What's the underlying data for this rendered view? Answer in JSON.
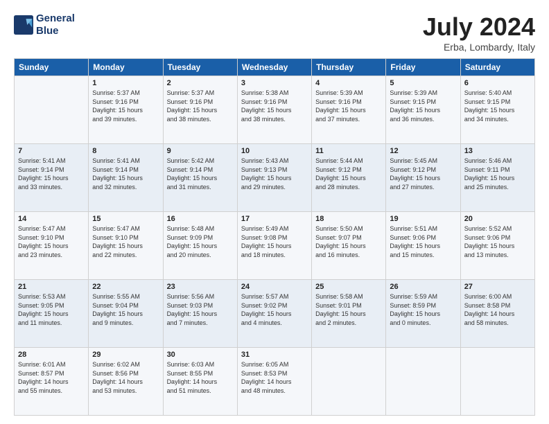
{
  "logo": {
    "line1": "General",
    "line2": "Blue"
  },
  "title": "July 2024",
  "subtitle": "Erba, Lombardy, Italy",
  "header": {
    "days": [
      "Sunday",
      "Monday",
      "Tuesday",
      "Wednesday",
      "Thursday",
      "Friday",
      "Saturday"
    ]
  },
  "weeks": [
    [
      {
        "day": "",
        "info": ""
      },
      {
        "day": "1",
        "info": "Sunrise: 5:37 AM\nSunset: 9:16 PM\nDaylight: 15 hours\nand 39 minutes."
      },
      {
        "day": "2",
        "info": "Sunrise: 5:37 AM\nSunset: 9:16 PM\nDaylight: 15 hours\nand 38 minutes."
      },
      {
        "day": "3",
        "info": "Sunrise: 5:38 AM\nSunset: 9:16 PM\nDaylight: 15 hours\nand 38 minutes."
      },
      {
        "day": "4",
        "info": "Sunrise: 5:39 AM\nSunset: 9:16 PM\nDaylight: 15 hours\nand 37 minutes."
      },
      {
        "day": "5",
        "info": "Sunrise: 5:39 AM\nSunset: 9:15 PM\nDaylight: 15 hours\nand 36 minutes."
      },
      {
        "day": "6",
        "info": "Sunrise: 5:40 AM\nSunset: 9:15 PM\nDaylight: 15 hours\nand 34 minutes."
      }
    ],
    [
      {
        "day": "7",
        "info": "Sunrise: 5:41 AM\nSunset: 9:14 PM\nDaylight: 15 hours\nand 33 minutes."
      },
      {
        "day": "8",
        "info": "Sunrise: 5:41 AM\nSunset: 9:14 PM\nDaylight: 15 hours\nand 32 minutes."
      },
      {
        "day": "9",
        "info": "Sunrise: 5:42 AM\nSunset: 9:14 PM\nDaylight: 15 hours\nand 31 minutes."
      },
      {
        "day": "10",
        "info": "Sunrise: 5:43 AM\nSunset: 9:13 PM\nDaylight: 15 hours\nand 29 minutes."
      },
      {
        "day": "11",
        "info": "Sunrise: 5:44 AM\nSunset: 9:12 PM\nDaylight: 15 hours\nand 28 minutes."
      },
      {
        "day": "12",
        "info": "Sunrise: 5:45 AM\nSunset: 9:12 PM\nDaylight: 15 hours\nand 27 minutes."
      },
      {
        "day": "13",
        "info": "Sunrise: 5:46 AM\nSunset: 9:11 PM\nDaylight: 15 hours\nand 25 minutes."
      }
    ],
    [
      {
        "day": "14",
        "info": "Sunrise: 5:47 AM\nSunset: 9:10 PM\nDaylight: 15 hours\nand 23 minutes."
      },
      {
        "day": "15",
        "info": "Sunrise: 5:47 AM\nSunset: 9:10 PM\nDaylight: 15 hours\nand 22 minutes."
      },
      {
        "day": "16",
        "info": "Sunrise: 5:48 AM\nSunset: 9:09 PM\nDaylight: 15 hours\nand 20 minutes."
      },
      {
        "day": "17",
        "info": "Sunrise: 5:49 AM\nSunset: 9:08 PM\nDaylight: 15 hours\nand 18 minutes."
      },
      {
        "day": "18",
        "info": "Sunrise: 5:50 AM\nSunset: 9:07 PM\nDaylight: 15 hours\nand 16 minutes."
      },
      {
        "day": "19",
        "info": "Sunrise: 5:51 AM\nSunset: 9:06 PM\nDaylight: 15 hours\nand 15 minutes."
      },
      {
        "day": "20",
        "info": "Sunrise: 5:52 AM\nSunset: 9:06 PM\nDaylight: 15 hours\nand 13 minutes."
      }
    ],
    [
      {
        "day": "21",
        "info": "Sunrise: 5:53 AM\nSunset: 9:05 PM\nDaylight: 15 hours\nand 11 minutes."
      },
      {
        "day": "22",
        "info": "Sunrise: 5:55 AM\nSunset: 9:04 PM\nDaylight: 15 hours\nand 9 minutes."
      },
      {
        "day": "23",
        "info": "Sunrise: 5:56 AM\nSunset: 9:03 PM\nDaylight: 15 hours\nand 7 minutes."
      },
      {
        "day": "24",
        "info": "Sunrise: 5:57 AM\nSunset: 9:02 PM\nDaylight: 15 hours\nand 4 minutes."
      },
      {
        "day": "25",
        "info": "Sunrise: 5:58 AM\nSunset: 9:01 PM\nDaylight: 15 hours\nand 2 minutes."
      },
      {
        "day": "26",
        "info": "Sunrise: 5:59 AM\nSunset: 8:59 PM\nDaylight: 15 hours\nand 0 minutes."
      },
      {
        "day": "27",
        "info": "Sunrise: 6:00 AM\nSunset: 8:58 PM\nDaylight: 14 hours\nand 58 minutes."
      }
    ],
    [
      {
        "day": "28",
        "info": "Sunrise: 6:01 AM\nSunset: 8:57 PM\nDaylight: 14 hours\nand 55 minutes."
      },
      {
        "day": "29",
        "info": "Sunrise: 6:02 AM\nSunset: 8:56 PM\nDaylight: 14 hours\nand 53 minutes."
      },
      {
        "day": "30",
        "info": "Sunrise: 6:03 AM\nSunset: 8:55 PM\nDaylight: 14 hours\nand 51 minutes."
      },
      {
        "day": "31",
        "info": "Sunrise: 6:05 AM\nSunset: 8:53 PM\nDaylight: 14 hours\nand 48 minutes."
      },
      {
        "day": "",
        "info": ""
      },
      {
        "day": "",
        "info": ""
      },
      {
        "day": "",
        "info": ""
      }
    ]
  ]
}
